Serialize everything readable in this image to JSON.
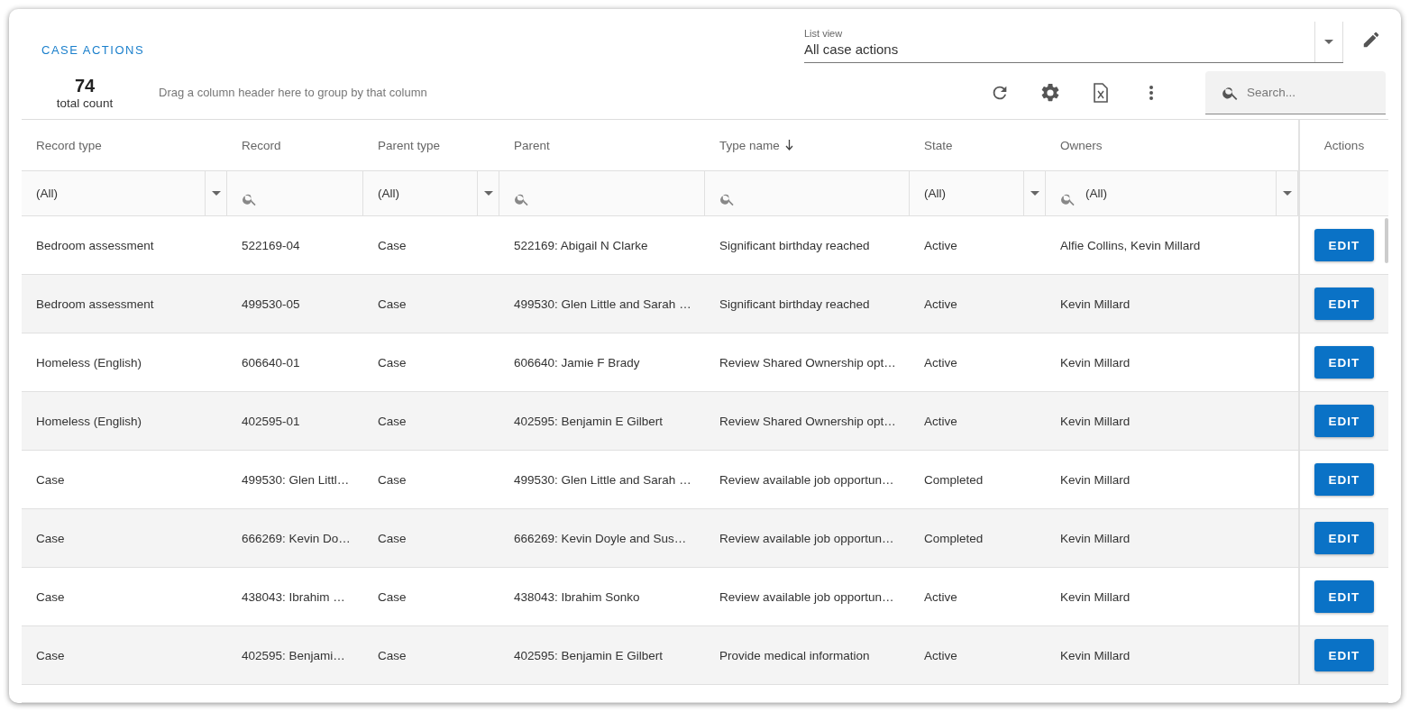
{
  "title": "CASE ACTIONS",
  "list_view": {
    "label": "List view",
    "value": "All case actions"
  },
  "total": {
    "count": "74",
    "label": "total count"
  },
  "group_hint": "Drag a column header here to group by that column",
  "search": {
    "placeholder": "Search..."
  },
  "table": {
    "columns": [
      {
        "label": "Record type",
        "sorted": false,
        "filter": {
          "kind": "select",
          "value": "(All)"
        }
      },
      {
        "label": "Record",
        "sorted": false,
        "filter": {
          "kind": "search"
        }
      },
      {
        "label": "Parent type",
        "sorted": false,
        "filter": {
          "kind": "select",
          "value": "(All)"
        }
      },
      {
        "label": "Parent",
        "sorted": false,
        "filter": {
          "kind": "search"
        }
      },
      {
        "label": "Type name",
        "sorted": true,
        "filter": {
          "kind": "search"
        }
      },
      {
        "label": "State",
        "sorted": false,
        "filter": {
          "kind": "select",
          "value": "(All)"
        }
      },
      {
        "label": "Owners",
        "sorted": false,
        "filter": {
          "kind": "search-select",
          "value": "(All)"
        }
      },
      {
        "label": "Actions",
        "sorted": false
      }
    ],
    "rows": [
      {
        "cells": [
          "Bedroom assessment",
          "522169-04",
          "Case",
          "522169: Abigail N Clarke",
          "Significant birthday reached",
          "Active",
          "Alfie Collins, Kevin Millard"
        ],
        "action": "EDIT"
      },
      {
        "cells": [
          "Bedroom assessment",
          "499530-05",
          "Case",
          "499530: Glen Little and Sarah …",
          "Significant birthday reached",
          "Active",
          "Kevin Millard"
        ],
        "action": "EDIT"
      },
      {
        "cells": [
          "Homeless (English)",
          "606640-01",
          "Case",
          "606640: Jamie F Brady",
          "Review Shared Ownership opt…",
          "Active",
          "Kevin Millard"
        ],
        "action": "EDIT"
      },
      {
        "cells": [
          "Homeless (English)",
          "402595-01",
          "Case",
          "402595: Benjamin E Gilbert",
          "Review Shared Ownership opt…",
          "Active",
          "Kevin Millard"
        ],
        "action": "EDIT"
      },
      {
        "cells": [
          "Case",
          "499530: Glen Littl…",
          "Case",
          "499530: Glen Little and Sarah …",
          "Review available job opportun…",
          "Completed",
          "Kevin Millard"
        ],
        "action": "EDIT"
      },
      {
        "cells": [
          "Case",
          "666269: Kevin Do…",
          "Case",
          "666269: Kevin Doyle and Sus…",
          "Review available job opportun…",
          "Completed",
          "Kevin Millard"
        ],
        "action": "EDIT"
      },
      {
        "cells": [
          "Case",
          "438043: Ibrahim …",
          "Case",
          "438043: Ibrahim Sonko",
          "Review available job opportun…",
          "Active",
          "Kevin Millard"
        ],
        "action": "EDIT"
      },
      {
        "cells": [
          "Case",
          "402595: Benjami…",
          "Case",
          "402595: Benjamin E Gilbert",
          "Provide medical information",
          "Active",
          "Kevin Millard"
        ],
        "action": "EDIT"
      }
    ]
  }
}
